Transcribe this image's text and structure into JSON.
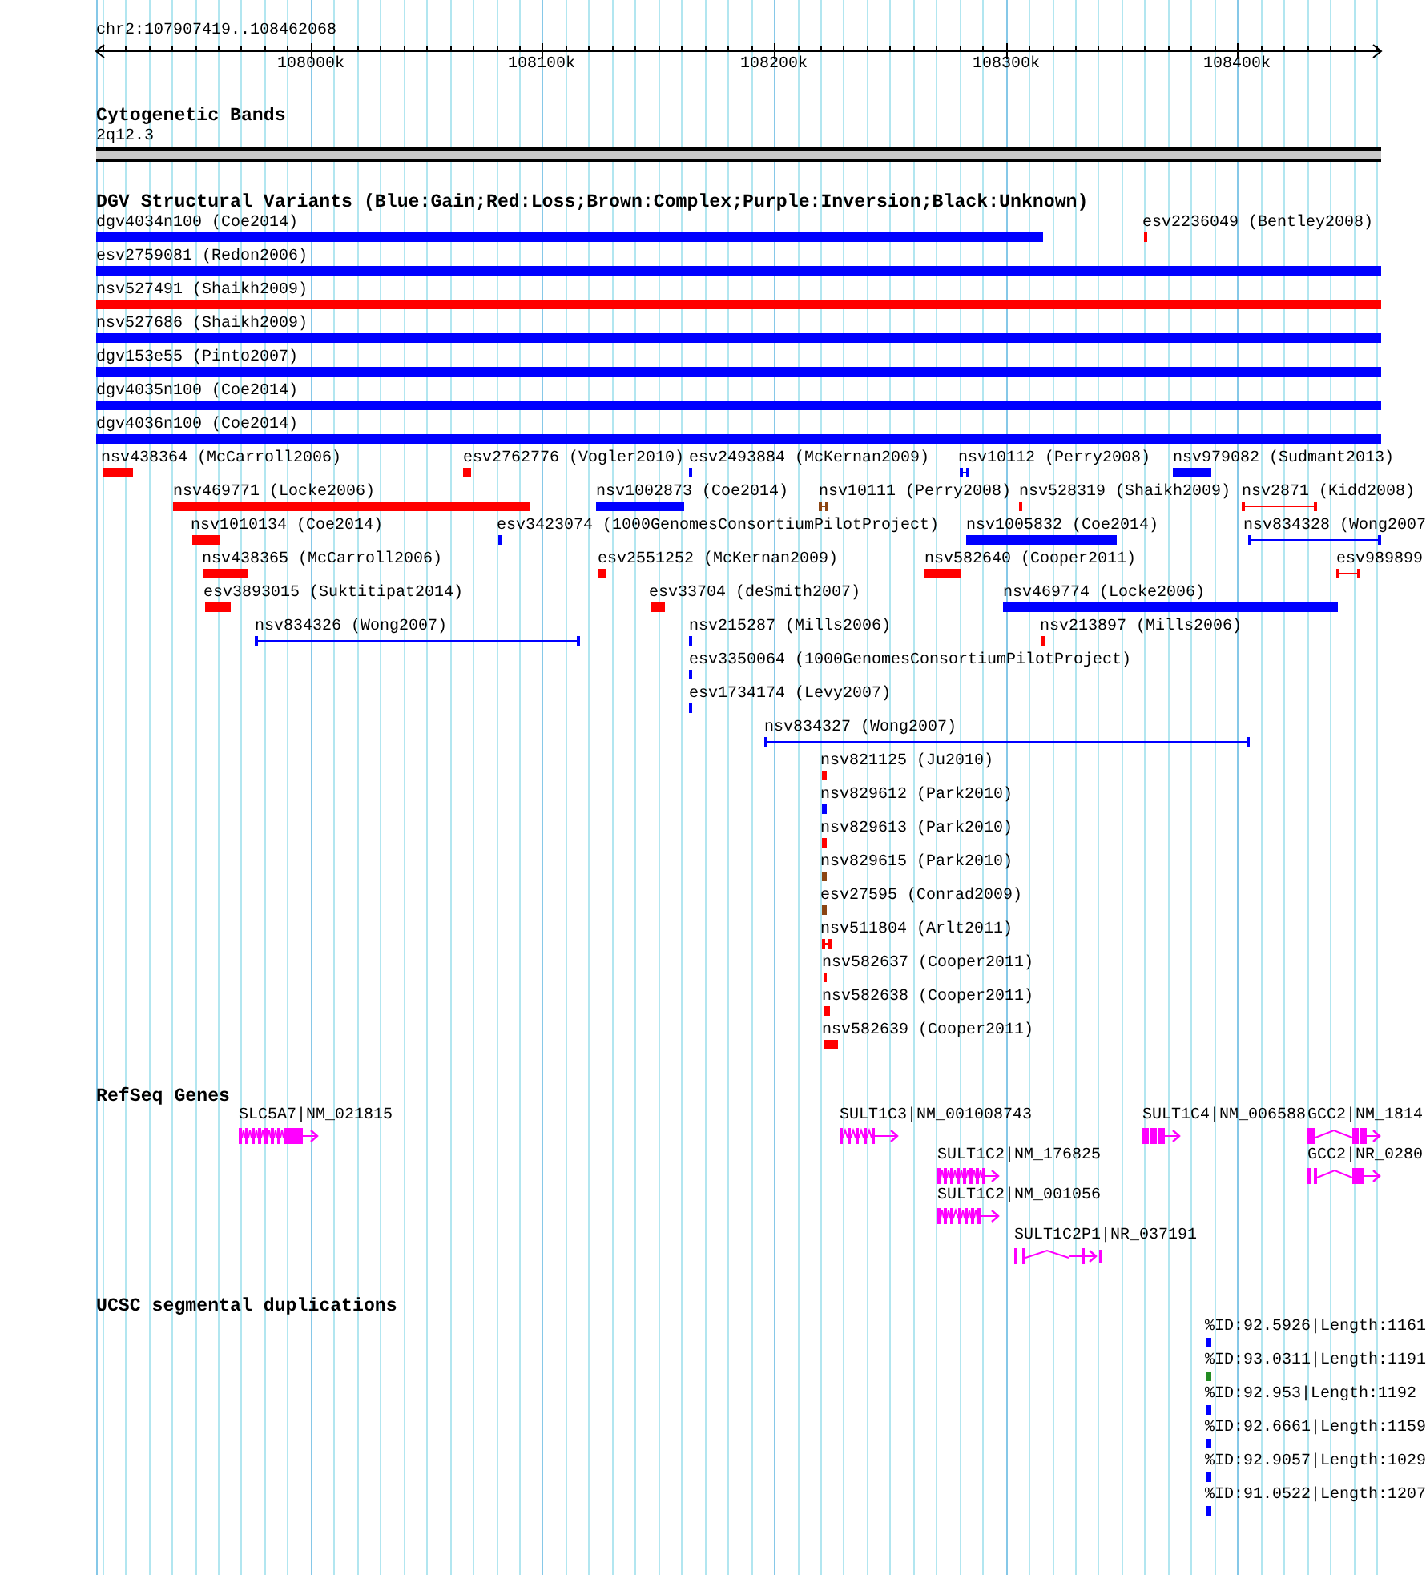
{
  "position": "chr2:107907419..108462068",
  "ruler": {
    "ticks": [
      "108000k",
      "108100k",
      "108200k",
      "108300k",
      "108400k"
    ]
  },
  "cytoband_track": {
    "title": "Cytogenetic Bands",
    "band": "2q12.3"
  },
  "dgv_track": {
    "title": "DGV Structural Variants (Blue:Gain;Red:Loss;Brown:Complex;Purple:Inversion;Black:Unknown)",
    "variants": [
      {
        "label": "dgv4034n100 (Coe2014)",
        "kind": "block",
        "color": "#0000ff"
      },
      {
        "label": "esv2236049 (Bentley2008)",
        "kind": "block",
        "color": "#ff0000"
      },
      {
        "label": "esv2759081 (Redon2006)",
        "kind": "block",
        "color": "#0000ff"
      },
      {
        "label": "nsv527491 (Shaikh2009)",
        "kind": "block",
        "color": "#ff0000"
      },
      {
        "label": "nsv527686 (Shaikh2009)",
        "kind": "block",
        "color": "#0000ff"
      },
      {
        "label": "dgv153e55 (Pinto2007)",
        "kind": "block",
        "color": "#0000ff"
      },
      {
        "label": "dgv4035n100 (Coe2014)",
        "kind": "block",
        "color": "#0000ff"
      },
      {
        "label": "dgv4036n100 (Coe2014)",
        "kind": "block",
        "color": "#0000ff"
      },
      {
        "label": "nsv438364 (McCarroll2006)",
        "kind": "block",
        "color": "#ff0000"
      },
      {
        "label": "esv2762776 (Vogler2010)",
        "kind": "block",
        "color": "#ff0000"
      },
      {
        "label": "esv2493884 (McKernan2009)",
        "kind": "block",
        "color": "#0000ff"
      },
      {
        "label": "nsv10112 (Perry2008)",
        "kind": "span",
        "color": "#0000ff"
      },
      {
        "label": "nsv979082 (Sudmant2013)",
        "kind": "block",
        "color": "#0000ff"
      },
      {
        "label": "nsv469771 (Locke2006)",
        "kind": "block",
        "color": "#ff0000"
      },
      {
        "label": "nsv1002873 (Coe2014)",
        "kind": "block",
        "color": "#0000ff"
      },
      {
        "label": "nsv10111 (Perry2008)",
        "kind": "span",
        "color": "#8b4513"
      },
      {
        "label": "nsv528319 (Shaikh2009)",
        "kind": "block",
        "color": "#ff0000"
      },
      {
        "label": "nsv2871 (Kidd2008)",
        "kind": "span",
        "color": "#ff0000"
      },
      {
        "label": "nsv1010134 (Coe2014)",
        "kind": "block",
        "color": "#ff0000"
      },
      {
        "label": "esv3423074 (1000GenomesConsortiumPilotProject)",
        "kind": "block",
        "color": "#0000ff"
      },
      {
        "label": "nsv1005832 (Coe2014)",
        "kind": "block",
        "color": "#0000ff"
      },
      {
        "label": "nsv834328 (Wong2007",
        "kind": "span",
        "color": "#0000ff"
      },
      {
        "label": "nsv438365 (McCarroll2006)",
        "kind": "block",
        "color": "#ff0000"
      },
      {
        "label": "esv2551252 (McKernan2009)",
        "kind": "block",
        "color": "#ff0000"
      },
      {
        "label": "nsv582640 (Cooper2011)",
        "kind": "block",
        "color": "#ff0000"
      },
      {
        "label": "esv989899",
        "kind": "span",
        "color": "#ff0000"
      },
      {
        "label": "esv3893015 (Suktitipat2014)",
        "kind": "block",
        "color": "#ff0000"
      },
      {
        "label": "esv33704 (deSmith2007)",
        "kind": "block",
        "color": "#ff0000"
      },
      {
        "label": "nsv469774 (Locke2006)",
        "kind": "block",
        "color": "#0000ff"
      },
      {
        "label": "nsv834326 (Wong2007)",
        "kind": "span",
        "color": "#0000ff"
      },
      {
        "label": "nsv215287 (Mills2006)",
        "kind": "block",
        "color": "#0000ff"
      },
      {
        "label": "nsv213897 (Mills2006)",
        "kind": "block",
        "color": "#ff0000"
      },
      {
        "label": "esv3350064 (1000GenomesConsortiumPilotProject)",
        "kind": "block",
        "color": "#0000ff"
      },
      {
        "label": "esv1734174 (Levy2007)",
        "kind": "block",
        "color": "#0000ff"
      },
      {
        "label": "nsv834327 (Wong2007)",
        "kind": "span",
        "color": "#0000ff"
      },
      {
        "label": "nsv821125 (Ju2010)",
        "kind": "block",
        "color": "#ff0000"
      },
      {
        "label": "nsv829612 (Park2010)",
        "kind": "block",
        "color": "#0000ff"
      },
      {
        "label": "nsv829613 (Park2010)",
        "kind": "block",
        "color": "#ff0000"
      },
      {
        "label": "nsv829615 (Park2010)",
        "kind": "block",
        "color": "#8b4513"
      },
      {
        "label": "esv27595 (Conrad2009)",
        "kind": "block",
        "color": "#8b4513"
      },
      {
        "label": "nsv511804 (Arlt2011)",
        "kind": "span",
        "color": "#ff0000"
      },
      {
        "label": "nsv582637 (Cooper2011)",
        "kind": "block",
        "color": "#ff0000"
      },
      {
        "label": "nsv582638 (Cooper2011)",
        "kind": "block",
        "color": "#ff0000"
      },
      {
        "label": "nsv582639 (Cooper2011)",
        "kind": "block",
        "color": "#ff0000"
      }
    ]
  },
  "refseq_track": {
    "title": "RefSeq Genes",
    "genes": [
      "SLC5A7|NM_021815",
      "SULT1C3|NM_001008743",
      "SULT1C4|NM_006588",
      "GCC2|NM_1814",
      "SULT1C2|NM_176825",
      "GCC2|NR_0280",
      "SULT1C2|NM_001056",
      "SULT1C2P1|NR_037191"
    ]
  },
  "segdup_track": {
    "title": "UCSC segmental duplications",
    "items": [
      {
        "label": "%ID:92.5926|Length:1161",
        "color": "#0000ff"
      },
      {
        "label": "%ID:93.0311|Length:1191",
        "color": "#228b22"
      },
      {
        "label": "%ID:92.953|Length:1192",
        "color": "#0000ff"
      },
      {
        "label": "%ID:92.6661|Length:1159",
        "color": "#0000ff"
      },
      {
        "label": "%ID:92.9057|Length:1029",
        "color": "#0000ff"
      },
      {
        "label": "%ID:91.0522|Length:1207",
        "color": "#0000ff"
      }
    ]
  }
}
